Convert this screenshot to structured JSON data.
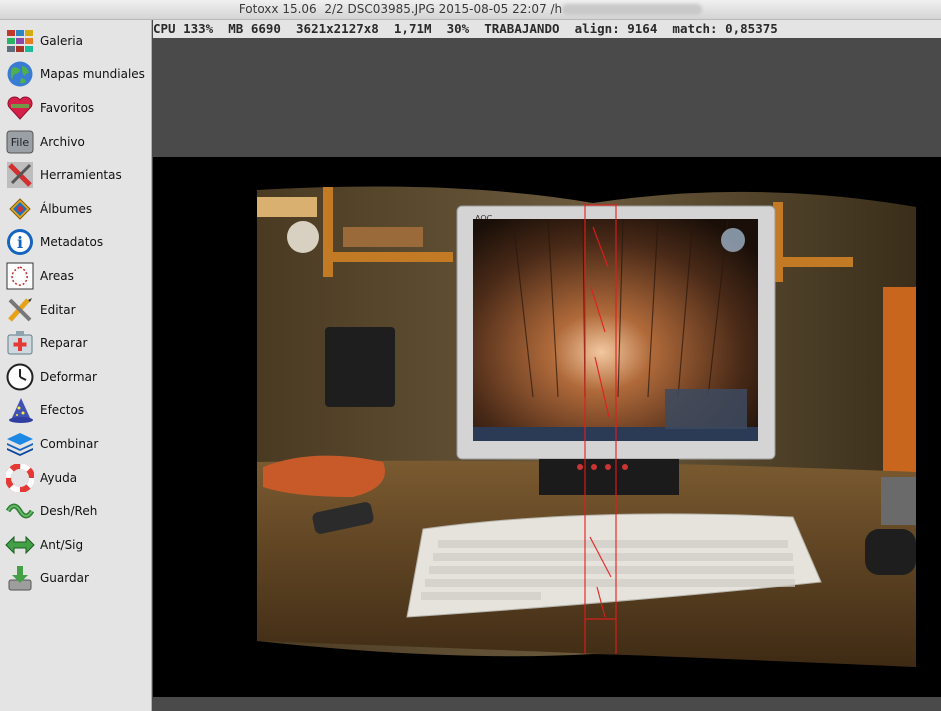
{
  "window": {
    "title_app": "Fotoxx 15.06",
    "title_rest": "2/2  DSC03985.JPG  2015-08-05 22:07  /h"
  },
  "status_bar": {
    "cpu": "CPU 133%",
    "mb": "MB 6690",
    "dims": "3621x2127x8",
    "size": "1,71M",
    "zoom": "30%",
    "state": "TRABAJANDO",
    "align": "align: 9164",
    "match": "match: 0,85375"
  },
  "sidebar": {
    "items": [
      {
        "label": "Galeria",
        "icon": "gallery-icon"
      },
      {
        "label": "Mapas mundiales",
        "icon": "globe-icon"
      },
      {
        "label": "Favoritos",
        "icon": "heart-icon"
      },
      {
        "label": "Archivo",
        "icon": "file-icon"
      },
      {
        "label": "Herramientas",
        "icon": "tools-icon"
      },
      {
        "label": "Álbumes",
        "icon": "albums-icon"
      },
      {
        "label": "Metadatos",
        "icon": "info-icon"
      },
      {
        "label": "Areas",
        "icon": "area-select-icon"
      },
      {
        "label": "Editar",
        "icon": "edit-icon"
      },
      {
        "label": "Reparar",
        "icon": "repair-icon"
      },
      {
        "label": "Deformar",
        "icon": "clock-icon"
      },
      {
        "label": "Efectos",
        "icon": "wizard-hat-icon"
      },
      {
        "label": "Combinar",
        "icon": "layers-icon"
      },
      {
        "label": "Ayuda",
        "icon": "lifebuoy-icon"
      },
      {
        "label": "Desh/Reh",
        "icon": "undo-redo-icon"
      },
      {
        "label": "Ant/Sig",
        "icon": "prev-next-icon"
      },
      {
        "label": "Guardar",
        "icon": "save-icon"
      }
    ]
  },
  "monitor_brand": "AOC",
  "image_alt": "Panorama being stitched: desk with AOC monitor showing wood wallpaper desktop and a keyboard; red alignment band through center"
}
